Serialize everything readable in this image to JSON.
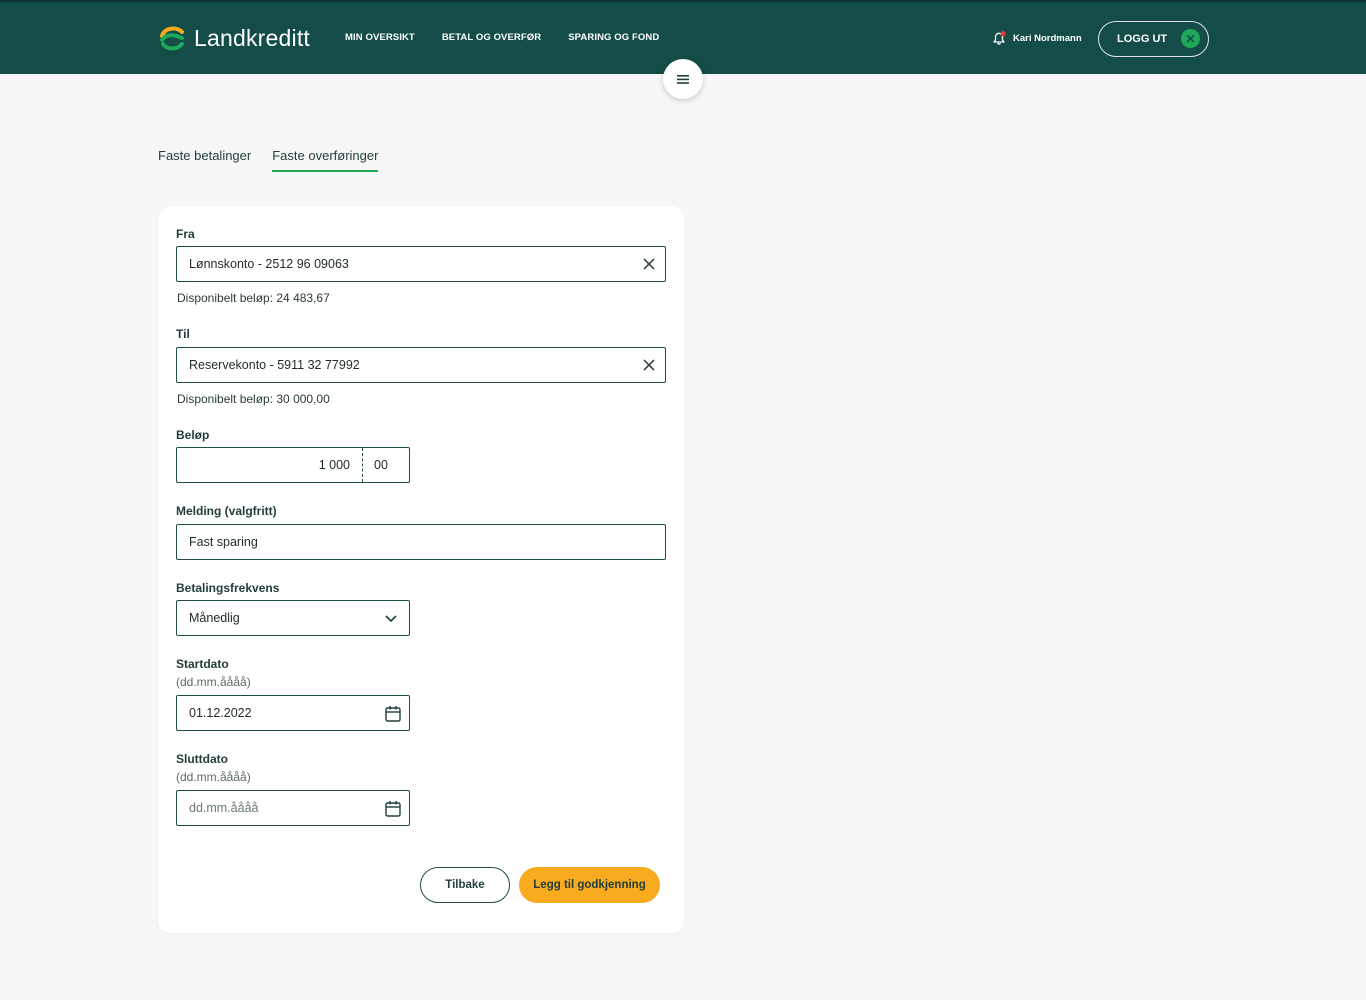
{
  "header": {
    "brand": "Landkreditt",
    "nav": [
      "MIN OVERSIKT",
      "BETAL OG OVERFØR",
      "SPARING OG FOND"
    ],
    "user_name": "Kari Nordmann",
    "logout_label": "LOGG UT",
    "logout_icon": "close-icon"
  },
  "tabs": [
    {
      "label": "Faste betalinger",
      "active": false
    },
    {
      "label": "Faste overføringer",
      "active": true
    }
  ],
  "form": {
    "from": {
      "label": "Fra",
      "value": "Lønnskonto - 2512 96 09063",
      "available": "Disponibelt beløp: 24 483,67"
    },
    "to": {
      "label": "Til",
      "value": "Reservekonto - 5911 32 77992",
      "available": "Disponibelt beløp: 30 000,00"
    },
    "amount": {
      "label": "Beløp",
      "kroner": "1 000",
      "ore": "00"
    },
    "message": {
      "label": "Melding (valgfritt)",
      "value": "Fast sparing"
    },
    "frequency": {
      "label": "Betalingsfrekvens",
      "value": "Månedlig"
    },
    "start_date": {
      "label": "Startdato",
      "format": "(dd.mm.åååå)",
      "value": "01.12.2022"
    },
    "end_date": {
      "label": "Sluttdato",
      "format": "(dd.mm.åååå)",
      "placeholder": "dd.mm.åååå"
    },
    "back_label": "Tilbake",
    "submit_label": "Legg til godkjenning"
  },
  "colors": {
    "header_bg": "#144d47",
    "accent_green": "#1fa85a",
    "primary_button": "#f8ab1e",
    "border": "#1f4d48"
  }
}
